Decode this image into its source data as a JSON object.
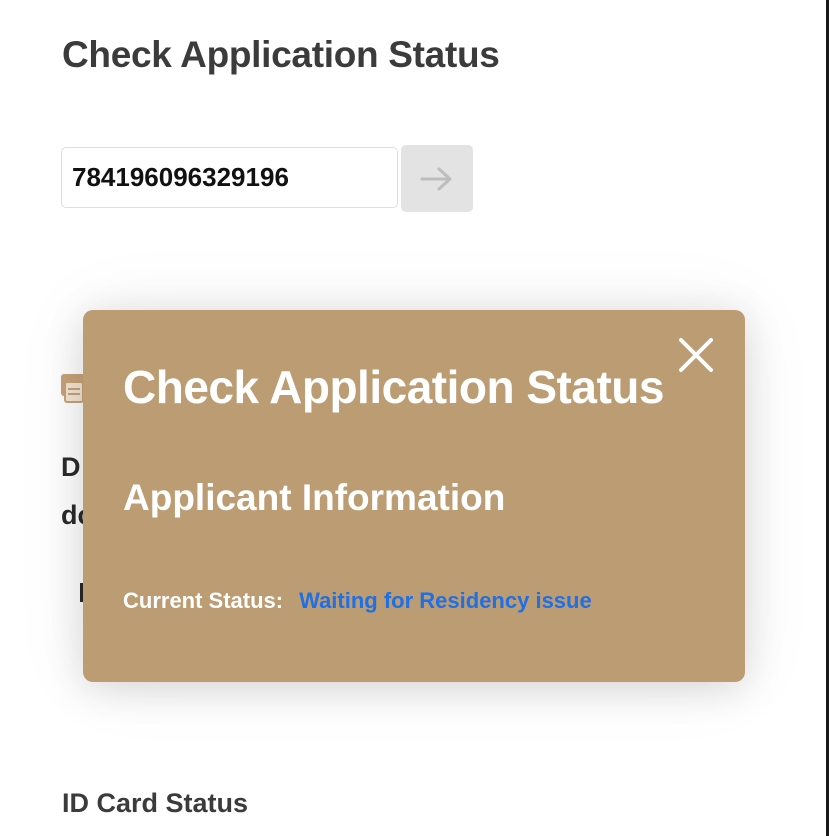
{
  "page": {
    "title": "Check Application Status",
    "application_number": "784196096329196",
    "submit_icon": "arrow-right-icon",
    "section_label": "ID Card Status",
    "obscured_text": {
      "line1_letter": "D",
      "line2_letters": "dc"
    }
  },
  "modal": {
    "title": "Check Application Status",
    "subtitle": "Applicant Information",
    "status_label": "Current Status:",
    "status_value": "Waiting for Residency issue",
    "close_icon": "close-icon"
  },
  "colors": {
    "modal_background": "#bc9c72",
    "status_value": "#1f6fe6",
    "accent_icon": "#c8a37a",
    "button_background": "#e3e3e3"
  }
}
